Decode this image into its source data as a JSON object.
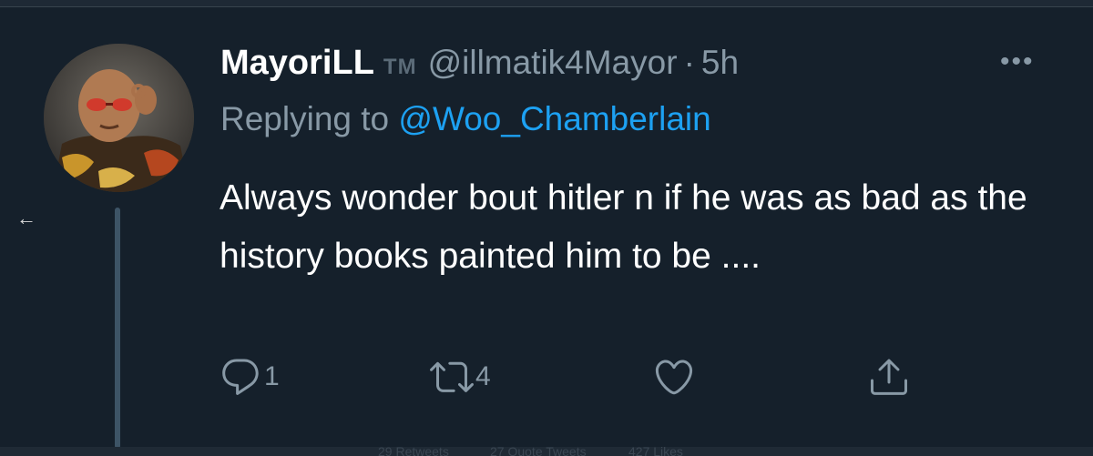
{
  "tweet": {
    "display_name": "MayoriLL",
    "name_badge": "TM",
    "handle": "@illmatik4Mayor",
    "separator": "·",
    "time": "5h",
    "more_label": "•••",
    "replying_prefix": "Replying to",
    "replying_to": "@Woo_Chamberlain",
    "text": "Always wonder bout hitler n if he was as bad as the history books painted him to be ....",
    "actions": {
      "reply_count": "1",
      "retweet_count": "4"
    }
  },
  "nav": {
    "back_icon": "←"
  },
  "faded_stats": {
    "retweets": "29 Retweets",
    "quote_tweets": "27 Quote Tweets",
    "likes": "427 Likes"
  },
  "colors": {
    "background": "#15202b",
    "secondary_text": "#8899a6",
    "accent": "#1da1f2",
    "thread_line": "#3d5466"
  }
}
